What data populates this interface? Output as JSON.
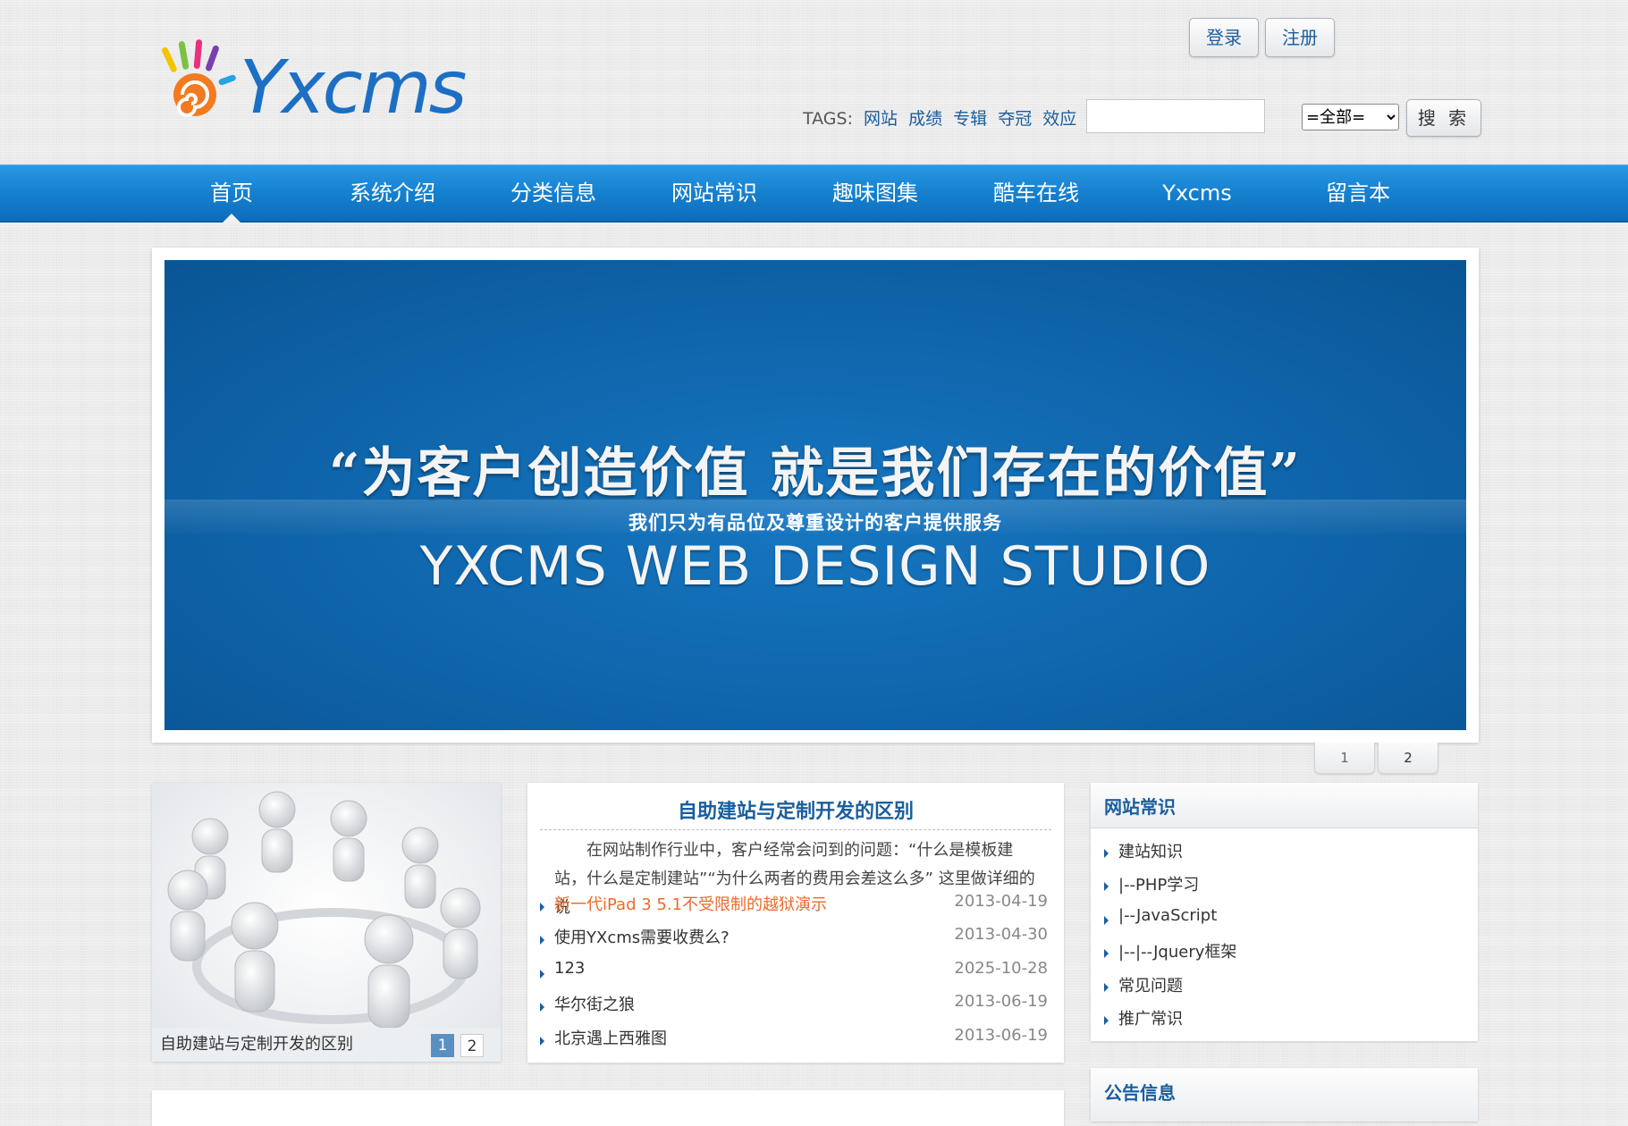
{
  "brand": {
    "name": "Yxcms"
  },
  "header": {
    "login_label": "登录",
    "register_label": "注册",
    "tags_label": "TAGS:",
    "tags": [
      "网站",
      "成绩",
      "专辑",
      "夺冠",
      "效应"
    ],
    "tags_more": "...",
    "search_placeholder": "",
    "search_select_value": "=全部=",
    "search_button_label": "搜 索"
  },
  "nav": {
    "items": [
      "首页",
      "系统介绍",
      "分类信息",
      "网站常识",
      "趣味图集",
      "酷车在线",
      "Yxcms",
      "留言本"
    ],
    "active_index": 0
  },
  "banner": {
    "slogan": "“为客户创造价值  就是我们存在的价值”",
    "subline": "我们只为有品位及尊重设计的客户提供服务",
    "studio": "YXCMS WEB DESIGN STUDIO",
    "pager": [
      "1",
      "2"
    ],
    "active_page": 1
  },
  "photo_box": {
    "caption": "自助建站与定制开发的区别",
    "pages": [
      "1",
      "2"
    ],
    "active_page": 1
  },
  "article": {
    "title": "自助建站与定制开发的区别",
    "summary": "在网站制作行业中，客户经常会问到的问题：“什么是模板建站，什么是定制建站”“为什么两者的费用会差这么多” 这里做详细的说",
    "news": [
      {
        "title": "新一代iPad 3 5.1不受限制的越狱演示",
        "date": "2013-04-19",
        "highlight": true
      },
      {
        "title": "使用YXcms需要收费么?",
        "date": "2013-04-30",
        "highlight": false
      },
      {
        "title": "123",
        "date": "2025-10-28",
        "highlight": false
      },
      {
        "title": "华尔街之狼",
        "date": "2013-06-19",
        "highlight": false
      },
      {
        "title": "北京遇上西雅图",
        "date": "2013-06-19",
        "highlight": false
      }
    ]
  },
  "sidebar": {
    "title": "网站常识",
    "items": [
      "建站知识",
      "|--PHP学习",
      "|--JavaScript",
      "|--|--Jquery框架",
      "常见问题",
      "推广常识"
    ]
  },
  "notice": {
    "title": "公告信息"
  },
  "colors": {
    "nav_blue": "#1580cf",
    "link_blue": "#1a5e9e",
    "hot_orange": "#ee6a2a",
    "banner_blue": "#0e63a8"
  }
}
